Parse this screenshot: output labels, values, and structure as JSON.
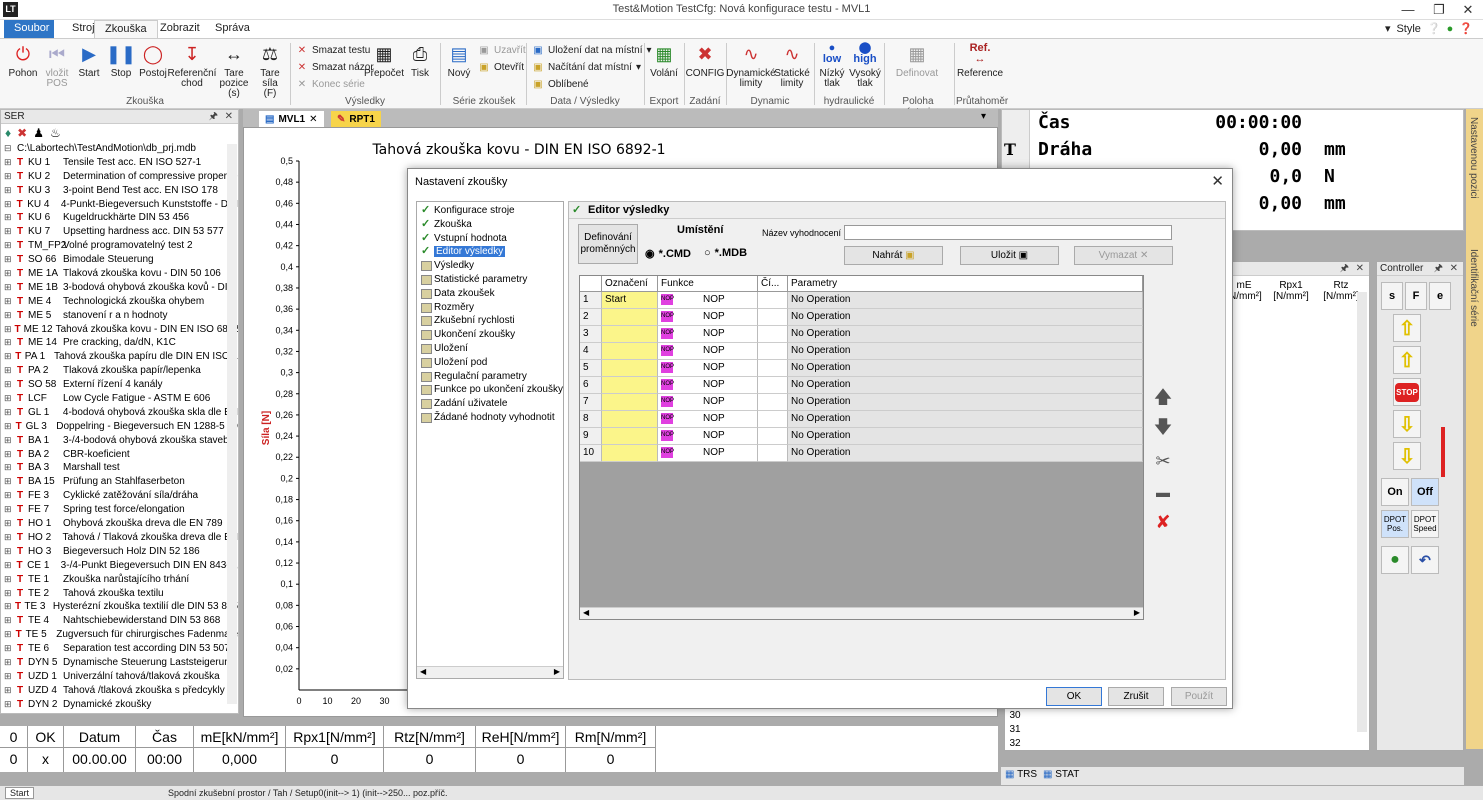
{
  "window": {
    "title": "Test&Motion  TestCfg: Nová konfigurace testu -  MVL1"
  },
  "app_tabs": [
    "Soubor",
    "Stroj",
    "Zkouška",
    "Zobrazit",
    "Správa"
  ],
  "style_label": "Style",
  "ribbon": {
    "buttons": [
      {
        "label": "Pohon",
        "icon": "power-icon"
      },
      {
        "label": "vložit POS",
        "icon": "insert-pos-icon"
      },
      {
        "label": "Start",
        "icon": "play-icon"
      },
      {
        "label": "Stop",
        "icon": "pause-icon"
      },
      {
        "label": "Postoj",
        "icon": "bicycle-icon"
      },
      {
        "label": "Referenční chod",
        "icon": "reference-icon"
      },
      {
        "label": "Tare pozice (s)",
        "icon": "tare-position-icon"
      },
      {
        "label": "Tare síla (F)",
        "icon": "weight-icon"
      }
    ],
    "group_zkouska": "Zkouška",
    "small_left": [
      "Smazat testu",
      "Smazat názor",
      "Konec série"
    ],
    "prepocet": "Přepočet",
    "tisk": "Tisk",
    "group_vysledky": "Výsledky",
    "novy": "Nový",
    "small_serie": [
      "Uzavřít",
      "Otevřít"
    ],
    "group_serie": "Série zkoušek",
    "small_data": [
      "Uložení dat na místní",
      "Načítání dat místní",
      "Oblíbené"
    ],
    "group_data": "Data / Výsledky",
    "volani": "Volání",
    "group_export": "Export",
    "config": "CONFIG",
    "group_zadani": "Zadání",
    "dyn_limits": "Dynamické limity",
    "stat_limits": "Statické limity",
    "group_dynamic": "Dynamic",
    "low": "Nízký tlak",
    "high": "Vysoký tlak",
    "low_tag": "low",
    "high_tag": "high",
    "group_hydraulicke": "hydraulické",
    "definovat": "Definovat",
    "group_poloha": "Poloha nástroje",
    "reference": "Reference",
    "ref_tag": "Ref.",
    "group_prutahomer": "Průtahoměr"
  },
  "ser_panel": {
    "title": "SER",
    "path": "C:\\Labortech\\TestAndMotion\\db_prj.mdb",
    "items": [
      [
        "KU 1",
        "Tensile Test acc. EN ISO 527-1"
      ],
      [
        "KU 2",
        "Determination of compressive propertie"
      ],
      [
        "KU 3",
        "3-point Bend Test acc. EN ISO 178"
      ],
      [
        "KU 4",
        "4-Punkt-Biegeversuch Kunststoffe - DIN"
      ],
      [
        "KU 6",
        "Kugeldruckhärte DIN 53 456"
      ],
      [
        "KU 7",
        "Upsetting hardness acc. DIN 53 577"
      ],
      [
        "TM_FP2",
        "Volné programovatelný test 2"
      ],
      [
        "SO 66",
        "Bimodale Steuerung"
      ],
      [
        "ME 1A",
        "Tlaková zkouška kovu - DIN 50 106"
      ],
      [
        "ME 1B",
        "3-bodová ohybová zkouška kovů - DIN"
      ],
      [
        "ME 4",
        "Technologická zkouška ohybem"
      ],
      [
        "ME 5",
        "stanovení r a n hodnoty"
      ],
      [
        "ME 12",
        "Tahová zkouška kovu - DIN EN ISO 6892"
      ],
      [
        "ME 14",
        "Pre cracking, da/dN, K1C"
      ],
      [
        "PA 1",
        "Tahová zkouška papíru dle DIN EN ISO 1"
      ],
      [
        "PA 2",
        "Tlaková zkouška papír/lepenka"
      ],
      [
        "SO 58",
        "Externí řízení 4 kanály"
      ],
      [
        "LCF",
        "Low Cycle Fatigue - ASTM E 606"
      ],
      [
        "GL 1",
        "4-bodová ohybová zkouška skla dle  EN"
      ],
      [
        "GL 3",
        "Doppelring - Biegeversuch EN 1288-5 (D"
      ],
      [
        "BA 1",
        "3-/4-bodová ohybová zkouška stavební"
      ],
      [
        "BA 2",
        "CBR-koeficient"
      ],
      [
        "BA 3",
        "Marshall test"
      ],
      [
        "BA 15",
        "Prüfung an Stahlfaserbeton"
      ],
      [
        "FE 3",
        "Cyklické zatěžování síla/dráha"
      ],
      [
        "FE 7",
        "Spring test force/elongation"
      ],
      [
        "HO 1",
        "Ohybová zkouška dreva dle EN 789"
      ],
      [
        "HO 2",
        "Tahová / Tlaková zkouška dreva dle EN"
      ],
      [
        "HO 3",
        "Biegeversuch Holz  DIN 52 186"
      ],
      [
        "CE 1",
        "3-/4-Punkt Biegeversuch DIN EN 843-1,"
      ],
      [
        "TE 1",
        "Zkouška narůstajícího trhání"
      ],
      [
        "TE 2",
        "Tahová zkouška textilu"
      ],
      [
        "TE 3",
        "Hysterézní zkouška textilií dle DIN 53 835"
      ],
      [
        "TE 4",
        "Nahtschiebewiderstand DIN 53 868"
      ],
      [
        "TE 5",
        "Zugversuch für chirurgisches Fadenmate"
      ],
      [
        "TE 6",
        "Separation test according DIN 53 507"
      ],
      [
        "DYN 5",
        "Dynamische Steuerung Laststeigerung"
      ],
      [
        "UZD 1",
        "Univerzální tahová/tlaková zkouška"
      ],
      [
        "UZD 4",
        "Tahová /tlaková zkouška s předcykly"
      ],
      [
        "DYN 2",
        "Dynamické zkoušky"
      ]
    ]
  },
  "doc_tabs": [
    "MVL1",
    "RPT1"
  ],
  "chart_data": {
    "type": "line",
    "title": "Tahová zkouška kovu - DIN EN ISO 6892-1",
    "ylabel": "Síla [N]",
    "yticks": [
      "0,5",
      "0,48",
      "0,46",
      "0,44",
      "0,42",
      "0,4",
      "0,38",
      "0,36",
      "0,34",
      "0,32",
      "0,3",
      "0,28",
      "0,26",
      "0,24",
      "0,22",
      "0,2",
      "0,18",
      "0,16",
      "0,14",
      "0,12",
      "0,1",
      "0,08",
      "0,06",
      "0,04",
      "0,02"
    ],
    "xticks": [
      "0",
      "10",
      "20",
      "30"
    ],
    "ylim": [
      0,
      0.5
    ],
    "series": []
  },
  "bottom_table": {
    "headers": [
      "0",
      "OK",
      "Datum",
      "Čas",
      "mE[kN/mm²]",
      "Rpx1[N/mm²]",
      "Rtz[N/mm²]",
      "ReH[N/mm²]",
      "Rm[N/mm²]"
    ],
    "row": [
      "0",
      "x",
      "00.00.00",
      "00:00",
      "0,000",
      "0",
      "0",
      "0",
      "0"
    ]
  },
  "status": {
    "start": "Start",
    "text": "Spodní zkušební prostor / Tah / Setup0(init--> 1)   (init-->250...   poz.příč."
  },
  "digital": {
    "rows": [
      {
        "label": "Čas",
        "value": "00:00:00",
        "unit": ""
      },
      {
        "label": "Dráha",
        "value": "0,00",
        "unit": "mm"
      },
      {
        "label": "",
        "value": "0,0",
        "unit": "N"
      },
      {
        "label": "",
        "value": "0,00",
        "unit": "mm"
      }
    ],
    "t_marker": "T"
  },
  "side_tabs": [
    "Nastavenou pozici",
    "Identifikační série"
  ],
  "results_panel": {
    "headers": [
      "mE [N/mm²]",
      "Rpx1 [N/mm²]",
      "Rtz [N/mm²]"
    ],
    "rows": [
      "30",
      "31",
      "32"
    ]
  },
  "controller": {
    "title": "Controller",
    "s": "s",
    "f": "F",
    "e": "e",
    "on": "On",
    "off": "Off",
    "dpot_pos": "DPOT Pos.",
    "dpot_speed": "DPOT Speed",
    "stop": "STOP"
  },
  "bottom_tabs": [
    "TRS",
    "STAT"
  ],
  "dialog": {
    "title": "Nastavení zkoušky",
    "nav": [
      {
        "label": "Konfigurace stroje",
        "state": "done"
      },
      {
        "label": "Zkouška",
        "state": "done"
      },
      {
        "label": "Vstupní hodnota",
        "state": "done"
      },
      {
        "label": "Editor výsledky",
        "state": "selected"
      },
      {
        "label": "Výsledky",
        "state": "page"
      },
      {
        "label": "Statistické parametry",
        "state": "page"
      },
      {
        "label": "Data zkoušek",
        "state": "page"
      },
      {
        "label": "Rozměry",
        "state": "page"
      },
      {
        "label": "Zkušební rychlosti",
        "state": "page"
      },
      {
        "label": "Ukončení zkoušky",
        "state": "page"
      },
      {
        "label": "Uložení",
        "state": "page"
      },
      {
        "label": "Uložení pod",
        "state": "page"
      },
      {
        "label": "Regulační parametry",
        "state": "page"
      },
      {
        "label": "Funkce po ukončení zkoušky",
        "state": "page"
      },
      {
        "label": "Zadání uživatele",
        "state": "page"
      },
      {
        "label": "Žádané hodnoty vyhodnotit",
        "state": "page"
      }
    ],
    "editor_title": "Editor výsledky",
    "define_vars": "Definování proměnných",
    "umisteni": "Umístění",
    "radio_cmd": "*.CMD",
    "radio_mdb": "*.MDB",
    "eval_name_label": "Název vyhodnocení",
    "eval_name_value": "",
    "load": "Nahrát",
    "save": "Uložit",
    "delete": "Vymazat",
    "grid_headers": [
      "",
      "Označení",
      "Funkce",
      "Čí...",
      "Parametry"
    ],
    "grid_rows": [
      {
        "n": "1",
        "name": "Start",
        "func": "NOP",
        "ci": "",
        "param": "No Operation"
      },
      {
        "n": "2",
        "name": "",
        "func": "NOP",
        "ci": "",
        "param": "No Operation"
      },
      {
        "n": "3",
        "name": "",
        "func": "NOP",
        "ci": "",
        "param": "No Operation"
      },
      {
        "n": "4",
        "name": "",
        "func": "NOP",
        "ci": "",
        "param": "No Operation"
      },
      {
        "n": "5",
        "name": "",
        "func": "NOP",
        "ci": "",
        "param": "No Operation"
      },
      {
        "n": "6",
        "name": "",
        "func": "NOP",
        "ci": "",
        "param": "No Operation"
      },
      {
        "n": "7",
        "name": "",
        "func": "NOP",
        "ci": "",
        "param": "No Operation"
      },
      {
        "n": "8",
        "name": "",
        "func": "NOP",
        "ci": "",
        "param": "No Operation"
      },
      {
        "n": "9",
        "name": "",
        "func": "NOP",
        "ci": "",
        "param": "No Operation"
      },
      {
        "n": "10",
        "name": "",
        "func": "NOP",
        "ci": "",
        "param": "No Operation"
      }
    ],
    "ok": "OK",
    "cancel": "Zrušit",
    "apply": "Použít"
  }
}
